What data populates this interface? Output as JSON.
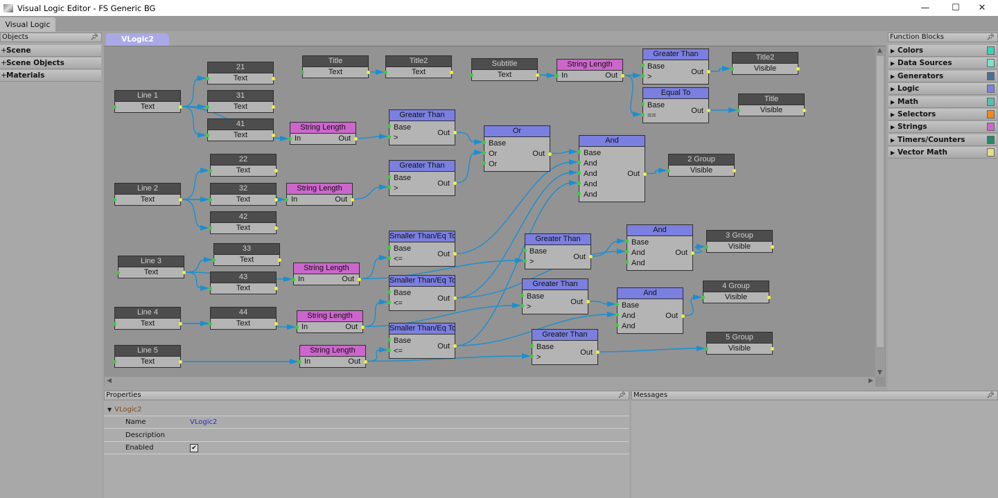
{
  "window": {
    "title": "Visual Logic Editor - FS Generic BG",
    "minimize": "—",
    "maximize": "☐",
    "close": "✕"
  },
  "main_tab": "Visual Logic",
  "objects_panel": {
    "title": "Objects",
    "items": [
      {
        "label": "Scene"
      },
      {
        "label": "Scene Objects"
      },
      {
        "label": "Materials"
      }
    ]
  },
  "canvas_tab": "VLogic2",
  "function_blocks": {
    "title": "Function Blocks",
    "items": [
      {
        "label": "Colors",
        "color": "#2fd6b8"
      },
      {
        "label": "Data Sources",
        "color": "#7fe0cc"
      },
      {
        "label": "Generators",
        "color": "#4a6f94"
      },
      {
        "label": "Logic",
        "color": "#7b7fe0"
      },
      {
        "label": "Math",
        "color": "#55bfae"
      },
      {
        "label": "Selectors",
        "color": "#f28a12"
      },
      {
        "label": "Strings",
        "color": "#cc66cc"
      },
      {
        "label": "Timers/Counters",
        "color": "#238a66"
      },
      {
        "label": "Vector Math",
        "color": "#e4e07e"
      }
    ]
  },
  "colors": {
    "logic": "#7b7fe0",
    "strings": "#cc66cc",
    "wire": "#1a8fd0"
  },
  "nodes": [
    {
      "id": "line1",
      "kind": "obj",
      "title": "Line 1",
      "row": "Text"
    },
    {
      "id": "n21",
      "kind": "obj",
      "title": "21",
      "row": "Text"
    },
    {
      "id": "n31",
      "kind": "obj",
      "title": "31",
      "row": "Text"
    },
    {
      "id": "n41",
      "kind": "obj",
      "title": "41",
      "row": "Text"
    },
    {
      "id": "title",
      "kind": "obj",
      "title": "Title",
      "row": "Text"
    },
    {
      "id": "title2a",
      "kind": "obj",
      "title": "Title2",
      "row": "Text"
    },
    {
      "id": "subtitle",
      "kind": "obj",
      "title": "Subtitle",
      "row": "Text"
    },
    {
      "id": "title2b",
      "kind": "obj",
      "title": "Title2",
      "row": "Visible"
    },
    {
      "id": "titleV",
      "kind": "obj",
      "title": "Title",
      "row": "Visible"
    },
    {
      "id": "line2",
      "kind": "obj",
      "title": "Line 2",
      "row": "Text"
    },
    {
      "id": "n22",
      "kind": "obj",
      "title": "22",
      "row": "Text"
    },
    {
      "id": "n32",
      "kind": "obj",
      "title": "32",
      "row": "Text"
    },
    {
      "id": "n42",
      "kind": "obj",
      "title": "42",
      "row": "Text"
    },
    {
      "id": "line3",
      "kind": "obj",
      "title": "Line 3",
      "row": "Text"
    },
    {
      "id": "n33",
      "kind": "obj",
      "title": "33",
      "row": "Text"
    },
    {
      "id": "n43",
      "kind": "obj",
      "title": "43",
      "row": "Text"
    },
    {
      "id": "line4",
      "kind": "obj",
      "title": "Line 4",
      "row": "Text"
    },
    {
      "id": "n44",
      "kind": "obj",
      "title": "44",
      "row": "Text"
    },
    {
      "id": "line5",
      "kind": "obj",
      "title": "Line 5",
      "row": "Text"
    },
    {
      "id": "g2",
      "kind": "obj",
      "title": "2 Group",
      "row": "Visible"
    },
    {
      "id": "g3",
      "kind": "obj",
      "title": "3 Group",
      "row": "Visible"
    },
    {
      "id": "g4",
      "kind": "obj",
      "title": "4 Group",
      "row": "Visible"
    },
    {
      "id": "g5",
      "kind": "obj",
      "title": "5 Group",
      "row": "Visible"
    },
    {
      "id": "slTop",
      "kind": "func",
      "cat": "strings",
      "title": "String Length",
      "inputs": [
        "In"
      ],
      "out": "Out"
    },
    {
      "id": "gtTop",
      "kind": "func",
      "cat": "logic",
      "title": "Greater Than",
      "inputs": [
        "Base",
        ">"
      ],
      "out": "Out"
    },
    {
      "id": "eqTo",
      "kind": "func",
      "cat": "logic",
      "title": "Equal To",
      "inputs": [
        "Base",
        "=="
      ],
      "out": "Out"
    },
    {
      "id": "sl1",
      "kind": "func",
      "cat": "strings",
      "title": "String Length",
      "inputs": [
        "In"
      ],
      "out": "Out"
    },
    {
      "id": "gt1",
      "kind": "func",
      "cat": "logic",
      "title": "Greater Than",
      "inputs": [
        "Base",
        ">"
      ],
      "out": "Out"
    },
    {
      "id": "or",
      "kind": "func",
      "cat": "logic",
      "title": "Or",
      "inputs": [
        "Base",
        "Or",
        "Or"
      ],
      "out": "Out"
    },
    {
      "id": "sl2",
      "kind": "func",
      "cat": "strings",
      "title": "String Length",
      "inputs": [
        "In"
      ],
      "out": "Out"
    },
    {
      "id": "gt2",
      "kind": "func",
      "cat": "logic",
      "title": "Greater Than",
      "inputs": [
        "Base",
        ">"
      ],
      "out": "Out"
    },
    {
      "id": "and1",
      "kind": "func",
      "cat": "logic",
      "title": "And",
      "inputs": [
        "Base",
        "And",
        "And",
        "And",
        "And"
      ],
      "out": "Out"
    },
    {
      "id": "stlq1",
      "kind": "func",
      "cat": "logic",
      "title": "Smaller Than/Eq To",
      "inputs": [
        "Base",
        "<="
      ],
      "out": "Out"
    },
    {
      "id": "gt3",
      "kind": "func",
      "cat": "logic",
      "title": "Greater Than",
      "inputs": [
        "Base",
        ">"
      ],
      "out": "Out"
    },
    {
      "id": "and2",
      "kind": "func",
      "cat": "logic",
      "title": "And",
      "inputs": [
        "Base",
        "And",
        "And"
      ],
      "out": "Out"
    },
    {
      "id": "sl3",
      "kind": "func",
      "cat": "strings",
      "title": "String Length",
      "inputs": [
        "In"
      ],
      "out": "Out"
    },
    {
      "id": "stlq2",
      "kind": "func",
      "cat": "logic",
      "title": "Smaller Than/Eq To",
      "inputs": [
        "Base",
        "<="
      ],
      "out": "Out"
    },
    {
      "id": "gt4",
      "kind": "func",
      "cat": "logic",
      "title": "Greater Than",
      "inputs": [
        "Base",
        ">"
      ],
      "out": "Out"
    },
    {
      "id": "and3",
      "kind": "func",
      "cat": "logic",
      "title": "And",
      "inputs": [
        "Base",
        "And",
        "And"
      ],
      "out": "Out"
    },
    {
      "id": "sl4",
      "kind": "func",
      "cat": "strings",
      "title": "String Length",
      "inputs": [
        "In"
      ],
      "out": "Out"
    },
    {
      "id": "stlq3",
      "kind": "func",
      "cat": "logic",
      "title": "Smaller Than/Eq To",
      "inputs": [
        "Base",
        "<="
      ],
      "out": "Out"
    },
    {
      "id": "gt5",
      "kind": "func",
      "cat": "logic",
      "title": "Greater Than",
      "inputs": [
        "Base",
        ">"
      ],
      "out": "Out"
    },
    {
      "id": "sl5",
      "kind": "func",
      "cat": "strings",
      "title": "String Length",
      "inputs": [
        "In"
      ],
      "out": "Out"
    }
  ],
  "connections": [
    [
      "line1",
      "n21",
      0
    ],
    [
      "line1",
      "n31",
      0
    ],
    [
      "line1",
      "n41",
      0
    ],
    [
      "line1",
      "sl1",
      0
    ],
    [
      "sl1",
      "gt1",
      1
    ],
    [
      "gt1",
      "or",
      0
    ],
    [
      "line2",
      "n22",
      0
    ],
    [
      "line2",
      "n32",
      0
    ],
    [
      "line2",
      "n42",
      0
    ],
    [
      "line2",
      "sl2",
      0
    ],
    [
      "sl2",
      "gt2",
      1
    ],
    [
      "gt2",
      "or",
      1
    ],
    [
      "or",
      "and1",
      0
    ],
    [
      "title",
      "title2a",
      0
    ],
    [
      "subtitle",
      "slTop",
      0
    ],
    [
      "slTop",
      "gtTop",
      1
    ],
    [
      "slTop",
      "eqTo",
      1
    ],
    [
      "gtTop",
      "title2b",
      0
    ],
    [
      "eqTo",
      "titleV",
      0
    ],
    [
      "and1",
      "g2",
      0
    ],
    [
      "line3",
      "n33",
      0
    ],
    [
      "line3",
      "n43",
      0
    ],
    [
      "line3",
      "sl3",
      0
    ],
    [
      "sl3",
      "stlq1",
      1
    ],
    [
      "sl3",
      "gt3",
      1
    ],
    [
      "stlq1",
      "and1",
      1
    ],
    [
      "line4",
      "n44",
      0
    ],
    [
      "line4",
      "sl4",
      0
    ],
    [
      "sl4",
      "stlq2",
      1
    ],
    [
      "sl4",
      "gt4",
      1
    ],
    [
      "stlq2",
      "and1",
      2
    ],
    [
      "stlq3",
      "and1",
      3
    ],
    [
      "gt3",
      "and2",
      0
    ],
    [
      "stlq2",
      "and2",
      1
    ],
    [
      "and2",
      "g3",
      0
    ],
    [
      "gt4",
      "and3",
      0
    ],
    [
      "stlq3",
      "and3",
      1
    ],
    [
      "and3",
      "g4",
      0
    ],
    [
      "line5",
      "sl5",
      0
    ],
    [
      "sl5",
      "stlq3",
      1
    ],
    [
      "sl5",
      "gt5",
      1
    ],
    [
      "gt5",
      "g5",
      0
    ]
  ],
  "properties": {
    "title": "Properties",
    "object": "VLogic2",
    "rows": [
      {
        "label": "Name",
        "value": "VLogic2"
      },
      {
        "label": "Description",
        "value": ""
      },
      {
        "label": "Enabled",
        "value": "✔"
      }
    ]
  },
  "messages": {
    "title": "Messages"
  }
}
